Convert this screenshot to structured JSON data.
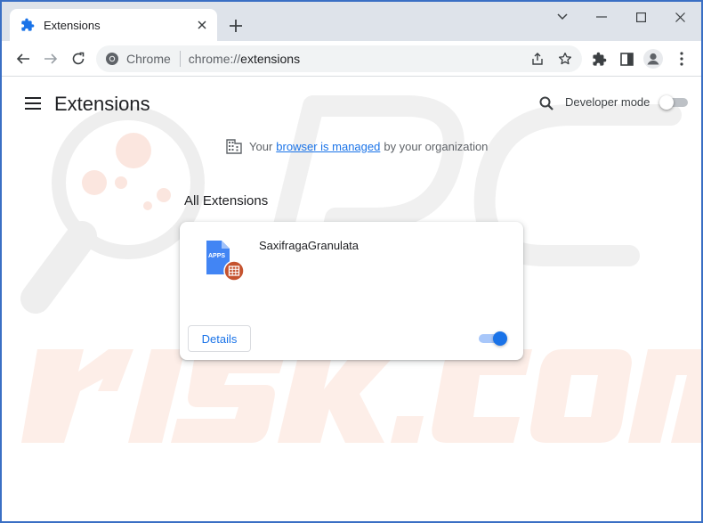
{
  "tab": {
    "title": "Extensions",
    "icon": "puzzle-piece-icon"
  },
  "window_controls": [
    "chevron-down-icon",
    "minimize-icon",
    "maximize-icon",
    "close-icon"
  ],
  "omnibox": {
    "site_label": "Chrome",
    "url_scheme": "chrome://",
    "url_path": "extensions"
  },
  "page": {
    "title": "Extensions",
    "developer_mode_label": "Developer mode",
    "developer_mode_enabled": false,
    "managed_notice": {
      "prefix": "Your",
      "link": "browser is managed",
      "suffix": "by your organization"
    },
    "section_title": "All Extensions",
    "extensions": [
      {
        "name": "SaxifragaGranulata",
        "icon_text": "APPS",
        "details_label": "Details",
        "enabled": true
      }
    ]
  },
  "watermark": {
    "brand_text": "risk.com"
  },
  "colors": {
    "accent": "#1a73e8",
    "window_border": "#3a6fc4",
    "tabstrip_bg": "#dee3ea",
    "badge": "#c5532f"
  }
}
